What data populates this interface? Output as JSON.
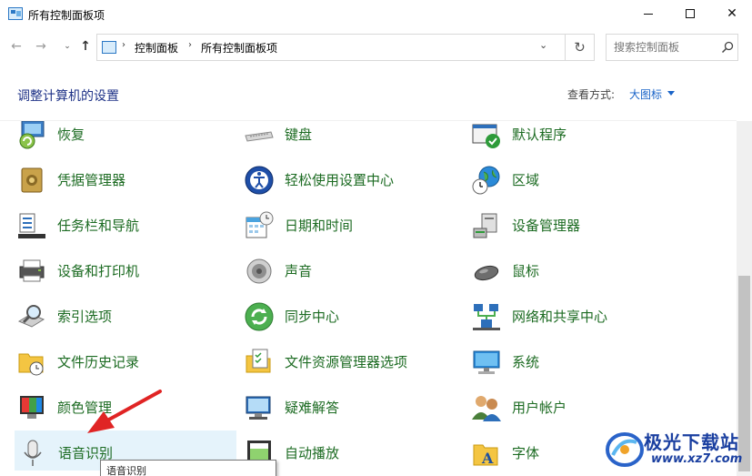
{
  "window": {
    "title": "所有控制面板项",
    "minimize_label": "",
    "maximize_label": "",
    "close_label": "✕"
  },
  "nav": {
    "back": "←",
    "forward": "→",
    "recent": "⌄",
    "up": "↑",
    "breadcrumb": [
      "控制面板",
      "所有控制面板项"
    ],
    "separator": "›",
    "dropdown": "⌄",
    "refresh": "↻"
  },
  "search": {
    "placeholder": "搜索控制面板"
  },
  "header": {
    "title": "调整计算机的设置",
    "view_label": "查看方式:",
    "view_value": "大图标"
  },
  "items": [
    {
      "label": "恢复",
      "icon": "recovery-icon"
    },
    {
      "label": "键盘",
      "icon": "keyboard-icon"
    },
    {
      "label": "默认程序",
      "icon": "default-programs-icon"
    },
    {
      "label": "凭据管理器",
      "icon": "credential-manager-icon"
    },
    {
      "label": "轻松使用设置中心",
      "icon": "ease-of-access-icon"
    },
    {
      "label": "区域",
      "icon": "region-globe-icon"
    },
    {
      "label": "任务栏和导航",
      "icon": "taskbar-icon"
    },
    {
      "label": "日期和时间",
      "icon": "date-time-icon"
    },
    {
      "label": "设备管理器",
      "icon": "device-manager-icon"
    },
    {
      "label": "设备和打印机",
      "icon": "printer-icon"
    },
    {
      "label": "声音",
      "icon": "sound-speaker-icon"
    },
    {
      "label": "鼠标",
      "icon": "mouse-icon"
    },
    {
      "label": "索引选项",
      "icon": "indexing-icon"
    },
    {
      "label": "同步中心",
      "icon": "sync-center-icon"
    },
    {
      "label": "网络和共享中心",
      "icon": "network-icon"
    },
    {
      "label": "文件历史记录",
      "icon": "file-history-icon"
    },
    {
      "label": "文件资源管理器选项",
      "icon": "folder-options-icon"
    },
    {
      "label": "系统",
      "icon": "system-monitor-icon"
    },
    {
      "label": "颜色管理",
      "icon": "color-management-icon"
    },
    {
      "label": "疑难解答",
      "icon": "troubleshooting-icon"
    },
    {
      "label": "用户帐户",
      "icon": "user-accounts-icon"
    },
    {
      "label": "语音识别",
      "icon": "microphone-icon"
    },
    {
      "label": "自动播放",
      "icon": "autoplay-icon"
    },
    {
      "label": "字体",
      "icon": "fonts-icon"
    }
  ],
  "tooltip": "语音识别",
  "watermark": {
    "title": "极光下载站",
    "url": "www.xz7.com"
  },
  "colors": {
    "link_green": "#1c6b22",
    "title_blue": "#1e3287",
    "hover_bg": "#e5f3fb",
    "arrow_red": "#e02424"
  }
}
